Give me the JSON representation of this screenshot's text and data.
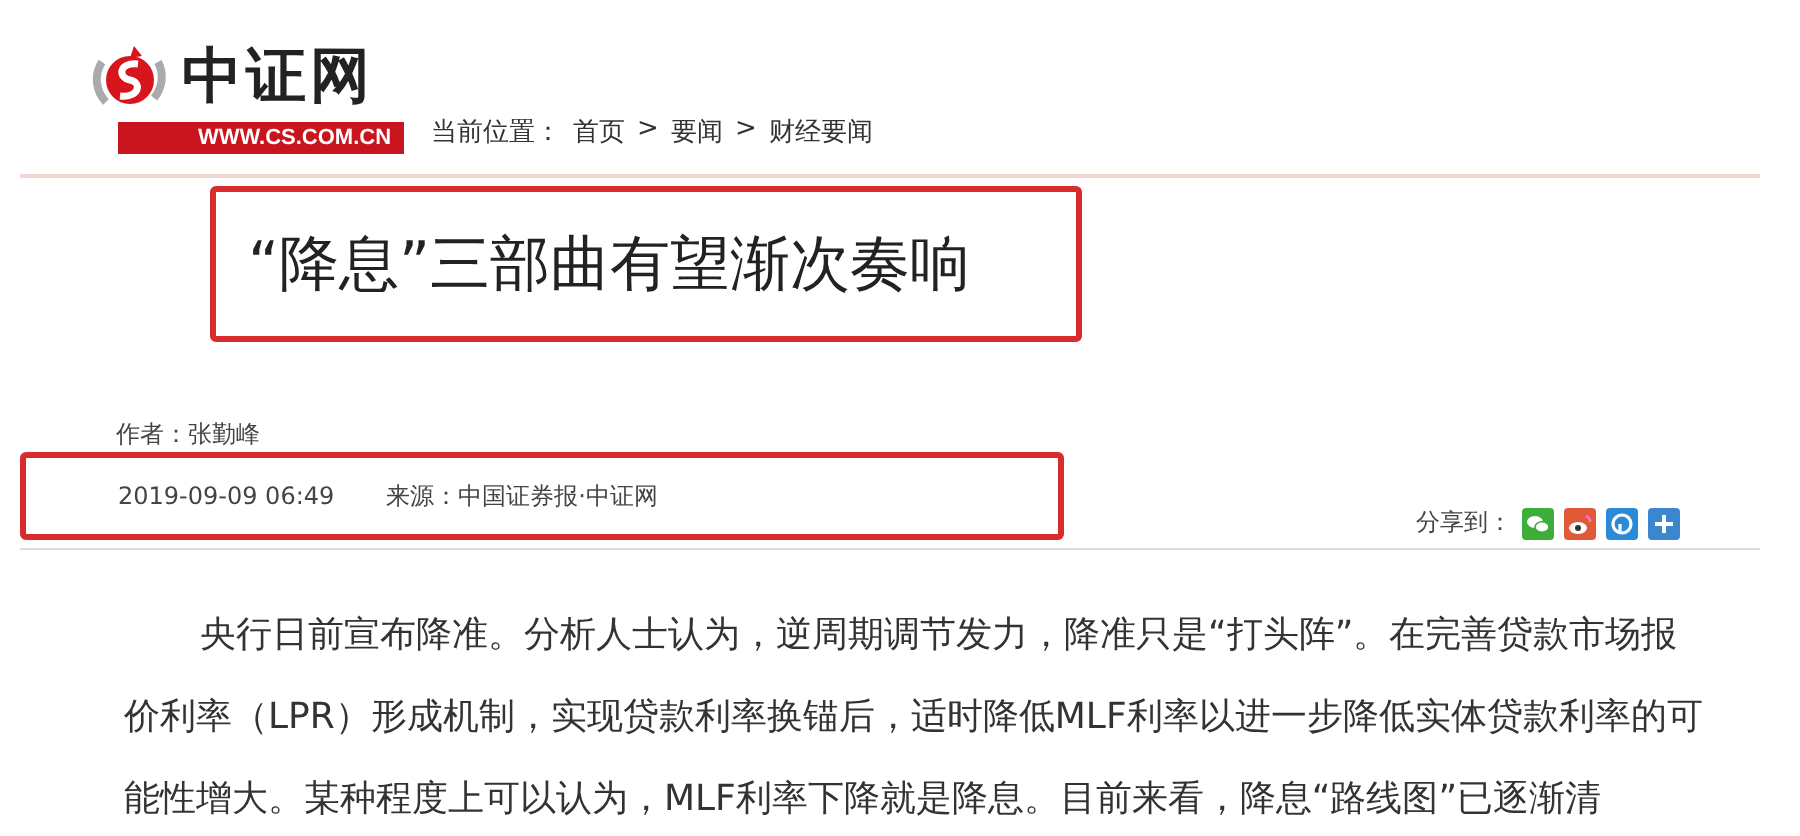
{
  "logo": {
    "name": "中证网",
    "url": "WWW.CS.COM.CN"
  },
  "breadcrumb": {
    "label": "当前位置：",
    "items": [
      "首页",
      "要闻",
      "财经要闻"
    ],
    "separator": ">"
  },
  "article": {
    "title": "“降息”三部曲有望渐次奏响",
    "author": "作者：张勤峰",
    "date": "2019-09-09 06:49",
    "source": "来源：中国证券报·中证网",
    "share": {
      "label": "分享到：",
      "services": [
        {
          "kind": "wechat"
        },
        {
          "kind": "weibo"
        },
        {
          "kind": "qzone"
        },
        {
          "kind": "more"
        }
      ]
    },
    "body": "央行日前宣布降准。分析人士认为，逆周期调节发力，降准只是“打头阵”。在完善贷款市场报价利率（LPR）形成机制，实现贷款利率换锚后，适时降低MLF利率以进一步降低实体贷款利率的可能性增大。某种程度上可以认为，MLF利率下降就是降息。目前来看，降息“路线图”已逐渐清"
  }
}
